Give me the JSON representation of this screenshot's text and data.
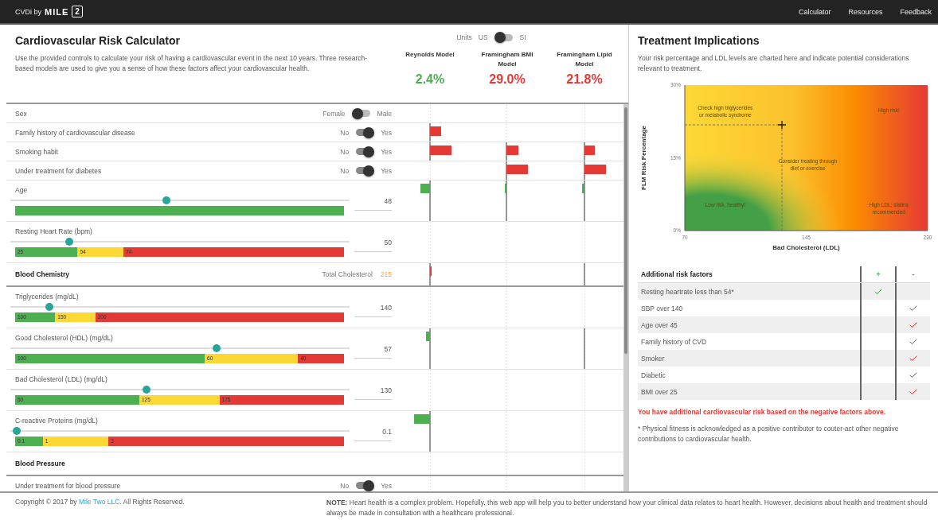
{
  "topbar": {
    "brand": "CVDi by",
    "logo_word": "MILE",
    "logo_mark": "2",
    "nav": [
      {
        "label": "Calculator"
      },
      {
        "label": "Resources"
      },
      {
        "label": "Feedback"
      }
    ]
  },
  "calculator": {
    "title": "Cardiovascular Risk Calculator",
    "description": "Use the provided controls to calculate your risk of having a cardiovascular event in the next 10 years. Three research-based models are used to give you a sense of how these factors affect your cardiovascular health.",
    "units": {
      "label": "Units",
      "off_label": "US",
      "on_label": "SI",
      "on": false
    },
    "models": [
      {
        "name": "Reynolds Model",
        "risk": "2.4%",
        "color": "#4caf50"
      },
      {
        "name": "Framingham BMI Model",
        "risk": "29.0%",
        "color": "#e53935"
      },
      {
        "name": "Framingham Lipid Model",
        "risk": "21.8%",
        "color": "#e53935"
      }
    ],
    "rows": [
      {
        "kind": "toggle",
        "label": "Sex",
        "off_label": "Female",
        "on_label": "Male",
        "on": false
      },
      {
        "kind": "toggle",
        "label": "Family history of cardiovascular disease",
        "off_label": "No",
        "on_label": "Yes",
        "on": true
      },
      {
        "kind": "toggle",
        "label": "Smoking habit",
        "off_label": "No",
        "on_label": "Yes",
        "on": true
      },
      {
        "kind": "toggle",
        "label": "Under treatment for diabetes",
        "off_label": "No",
        "on_label": "Yes",
        "on": true
      },
      {
        "kind": "slider",
        "label": "Age",
        "value": "48",
        "level": 0.46,
        "segments": [
          {
            "color": "#4caf50"
          }
        ]
      },
      {
        "kind": "slider",
        "label": "Resting Heart Rate (bpm)",
        "value": "50",
        "level": 0.165,
        "segments": [
          {
            "label": "25",
            "color": "#4caf50"
          },
          {
            "label": "54",
            "color": "#fdd835"
          },
          {
            "label": "74",
            "color": "#e53935"
          }
        ]
      },
      {
        "kind": "section",
        "label": "Blood Chemistry",
        "aside_label": "Total Cholesterol",
        "aside_value": "215"
      },
      {
        "kind": "slider",
        "label": "Triglycerides (mg/dL)",
        "value": "140",
        "level": 0.107,
        "segments": [
          {
            "label": "100",
            "color": "#4caf50"
          },
          {
            "label": "150",
            "color": "#fdd835"
          },
          {
            "label": "200",
            "color": "#e53935"
          }
        ]
      },
      {
        "kind": "slider",
        "label": "Good Cholesterol (HDL) (mg/dL)",
        "value": "57",
        "level": 0.61,
        "segments": [
          {
            "label": "100",
            "color": "#4caf50"
          },
          {
            "label": "60",
            "color": "#fdd835"
          },
          {
            "label": "40",
            "color": "#e53935"
          }
        ]
      },
      {
        "kind": "slider",
        "label": "Bad Cholesterol (LDL) (mg/dL)",
        "value": "130",
        "level": 0.4,
        "segments": [
          {
            "label": "50",
            "color": "#4caf50"
          },
          {
            "label": "125",
            "color": "#fdd835"
          },
          {
            "label": "175",
            "color": "#e53935"
          }
        ]
      },
      {
        "kind": "slider",
        "label": "C-reactive Proteins (mg/dL)",
        "value": "0.1",
        "level": 0.007,
        "segments": [
          {
            "label": "0.1",
            "color": "#4caf50"
          },
          {
            "label": "1",
            "color": "#fdd835"
          },
          {
            "label": "3",
            "color": "#e53935"
          }
        ]
      },
      {
        "kind": "section",
        "label": "Blood Pressure"
      },
      {
        "kind": "toggle",
        "label": "Under treatment for blood pressure",
        "off_label": "No",
        "on_label": "Yes",
        "on": true
      }
    ]
  },
  "treatment": {
    "title": "Treatment Implications",
    "description": "Your risk percentage and LDL levels are charted here and indicate potential considerations relevant to treatment.",
    "chart_data": {
      "type": "scatter",
      "xlabel": "Bad Cholesterol (LDL)",
      "ylabel": "FLM Risk Percentage",
      "x": [
        130
      ],
      "series": [
        {
          "color": "#222222",
          "values": [
            21.8
          ]
        }
      ],
      "ref_lines": [
        {
          "axis": "y",
          "value": 21.8
        },
        {
          "axis": "x",
          "value": 130
        }
      ],
      "xlim": [
        70,
        220
      ],
      "ylim": [
        0,
        30
      ],
      "xticks": [
        70,
        145,
        220
      ],
      "yticks": [
        {
          "value": 0,
          "label": "0%"
        },
        {
          "value": 15,
          "label": "15%"
        },
        {
          "value": 30,
          "label": "30%"
        }
      ],
      "annotations": [
        "Check high triglycerides or metabolic syndrome",
        "High risk!",
        "Consider treating through diet or exercise",
        "Low risk, healthy!",
        "High LDL; statins recommended"
      ]
    },
    "factors": {
      "headers": [
        "Additional risk factors",
        "+",
        "-"
      ],
      "rows": [
        {
          "label": "Resting heartrate less than 54*",
          "positive": true,
          "negative": false
        },
        {
          "label": "SBP over 140",
          "positive": false,
          "negative": true
        },
        {
          "label": "Age over 45",
          "positive": false,
          "negative": true
        },
        {
          "label": "Family history of CVD",
          "positive": false,
          "negative": true
        },
        {
          "label": "Smoker",
          "positive": false,
          "negative": true
        },
        {
          "label": "Diabetic",
          "positive": false,
          "negative": true
        },
        {
          "label": "BMI over 25",
          "positive": false,
          "negative": true
        }
      ]
    },
    "alert": "You have additional cardiovascular risk based on the negative factors above.",
    "footnote": "* Physical fitness is acknowledged as a positive contributor to couter-act other negative contributions to cardiovascular health."
  },
  "footer": {
    "copyright_before": "Copyright © 2017 by",
    "copyright_link": "Mile Two LLC",
    "copyright_after": ". All Rights Reserved.",
    "note": "**NOTE:** Heart health is a complex problem. Hopefully, this web app will help you to better understand how your clinical data relates to heart health. However, decisions about health and treatment should always be made in consultation with a healthcare professional."
  }
}
